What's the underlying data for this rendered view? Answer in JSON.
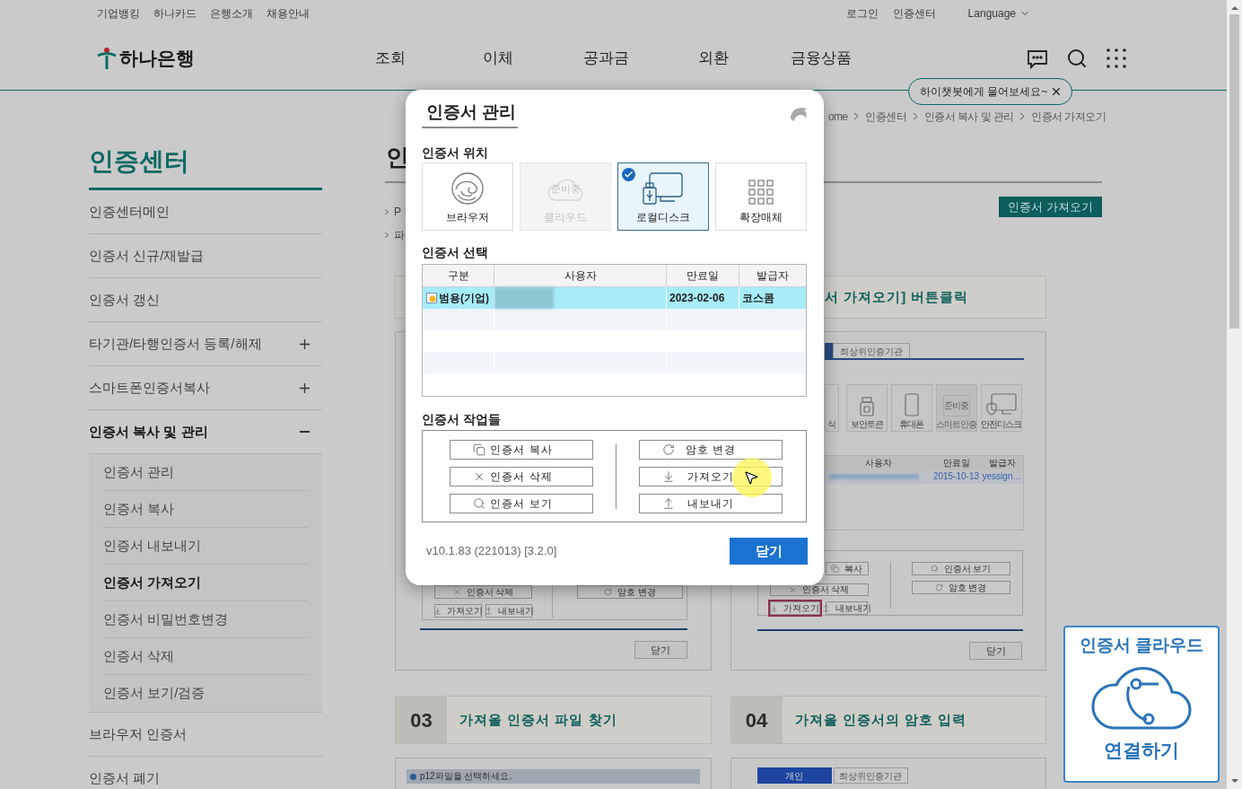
{
  "top_links": [
    "기업뱅킹",
    "하나카드",
    "은행소개",
    "채용안내"
  ],
  "account_links": [
    "로그인",
    "인증센터"
  ],
  "language": "Language",
  "logo": "하나은행",
  "nav": [
    "조회",
    "이체",
    "공과금",
    "외환",
    "금융상품"
  ],
  "chatbot_tip": "하이챗봇에게 물어보세요~",
  "breadcrumb": [
    "ome",
    "인증센터",
    "인증서 복사 및 관리",
    "인증서 가져오기"
  ],
  "sidebar": {
    "title": "인증센터",
    "items": [
      {
        "kind": "link",
        "label": "인증센터메인",
        "selected": false
      },
      {
        "kind": "link",
        "label": "인증서 신규/재발급",
        "selected": false
      },
      {
        "kind": "link",
        "label": "인증서 갱신",
        "selected": false
      },
      {
        "kind": "group",
        "label": "타기관/타행인증서 등록/해제",
        "selected": false,
        "expanded": false
      },
      {
        "kind": "group",
        "label": "스마트폰인증서복사",
        "selected": false,
        "expanded": false
      },
      {
        "kind": "group",
        "label": "인증서 복사 및 관리",
        "selected": true,
        "expanded": true,
        "children": [
          {
            "label": "인증서 관리",
            "selected": false
          },
          {
            "label": "인증서 복사",
            "selected": false
          },
          {
            "label": "인증서 내보내기",
            "selected": false
          },
          {
            "label": "인증서 가져오기",
            "selected": true
          },
          {
            "label": "인증서 비밀번호변경",
            "selected": false
          },
          {
            "label": "인증서 삭제",
            "selected": false
          },
          {
            "label": "인증서 보기/검증",
            "selected": false
          }
        ]
      },
      {
        "kind": "link",
        "label": "브라우저 인증서",
        "selected": false
      },
      {
        "kind": "link",
        "label": "인증서 폐기",
        "selected": false
      }
    ]
  },
  "page": {
    "title": "인",
    "bullets": [
      "P",
      "파"
    ],
    "import_button": "인증서 가져오기"
  },
  "step_headers": [
    {
      "title": "서 가져오기] 버튼클릭"
    },
    {
      "number": "03",
      "title": "가져올 인증서 파일 찾기"
    },
    {
      "number": "04",
      "title": "가져올 인증서의 암호 입력"
    }
  ],
  "left_screenshot": {
    "buttons": [
      {
        "kind": "delete",
        "label": "인증서 삭제",
        "highlighted": false
      },
      {
        "kind": "password",
        "label": "암호 변경",
        "highlighted": false
      },
      {
        "kind": "import",
        "label": "가져오기",
        "highlighted": false
      },
      {
        "kind": "export",
        "label": "내보내기",
        "highlighted": false
      }
    ],
    "close": "닫기"
  },
  "right_screenshot": {
    "tab": "최상위인증기관",
    "devices": [
      {
        "kind": "partial",
        "label": "식",
        "disabled": false
      },
      {
        "kind": "token",
        "label": "보안토큰",
        "disabled": false
      },
      {
        "kind": "phone",
        "label": "휴대폰",
        "disabled": false
      },
      {
        "kind": "smart",
        "label": "스마트인증",
        "disabled": true,
        "badge": "준비중"
      },
      {
        "kind": "disk",
        "label": "안전디스크",
        "disabled": false
      }
    ],
    "columns": [
      "사용자",
      "만료일",
      "발급자"
    ],
    "row": [
      "2015-10-13",
      "yessign…"
    ],
    "buttons": [
      {
        "kind": "copy",
        "label": "복사",
        "highlighted": false
      },
      {
        "kind": "delete",
        "label": "인증서 삭제",
        "highlighted": false
      },
      {
        "kind": "import",
        "label": "가져오기",
        "highlighted": true
      },
      {
        "kind": "export",
        "label": "내보내기",
        "highlighted": false
      },
      {
        "kind": "view",
        "label": "인증서 보기",
        "highlighted": false
      },
      {
        "kind": "password",
        "label": "암호 변경",
        "highlighted": false
      }
    ],
    "close": "닫기"
  },
  "file_dialog_title": "p12파일을 선택하세요.",
  "bottom_tabs": [
    {
      "label": "개인",
      "selected": true
    },
    {
      "label": "최상위인증기관",
      "selected": false
    }
  ],
  "cloud_widget": {
    "title": "인증서 클라우드",
    "action": "연결하기"
  },
  "modal": {
    "title": "인증서 관리",
    "location_label": "인증서 위치",
    "locations": [
      {
        "kind": "browser",
        "label": "브라우저",
        "selected": false,
        "disabled": false
      },
      {
        "kind": "cloud",
        "label": "클라우드",
        "selected": false,
        "disabled": true,
        "badge": "준비중"
      },
      {
        "kind": "local",
        "label": "로컬디스크",
        "selected": true,
        "disabled": false
      },
      {
        "kind": "external",
        "label": "확장매체",
        "selected": false,
        "disabled": false
      }
    ],
    "select_label": "인증서 선택",
    "columns": [
      "구분",
      "사용자",
      "만료일",
      "발급자"
    ],
    "rows": [
      {
        "type": "범용(기업)",
        "expiry": "2023-02-06",
        "issuer": "코스콤",
        "selected": true
      }
    ],
    "tasks_label": "인증서 작업들",
    "tasks_left": [
      {
        "kind": "copy",
        "label": "인증서 복사"
      },
      {
        "kind": "delete",
        "label": "인증서 삭제"
      },
      {
        "kind": "view",
        "label": "인증서 보기"
      }
    ],
    "tasks_right": [
      {
        "kind": "password",
        "label": "암호 변경"
      },
      {
        "kind": "import",
        "label": "가져오기"
      },
      {
        "kind": "export",
        "label": "내보내기"
      }
    ],
    "version": "v10.1.83 (221013) [3.2.0]",
    "close": "닫기"
  }
}
